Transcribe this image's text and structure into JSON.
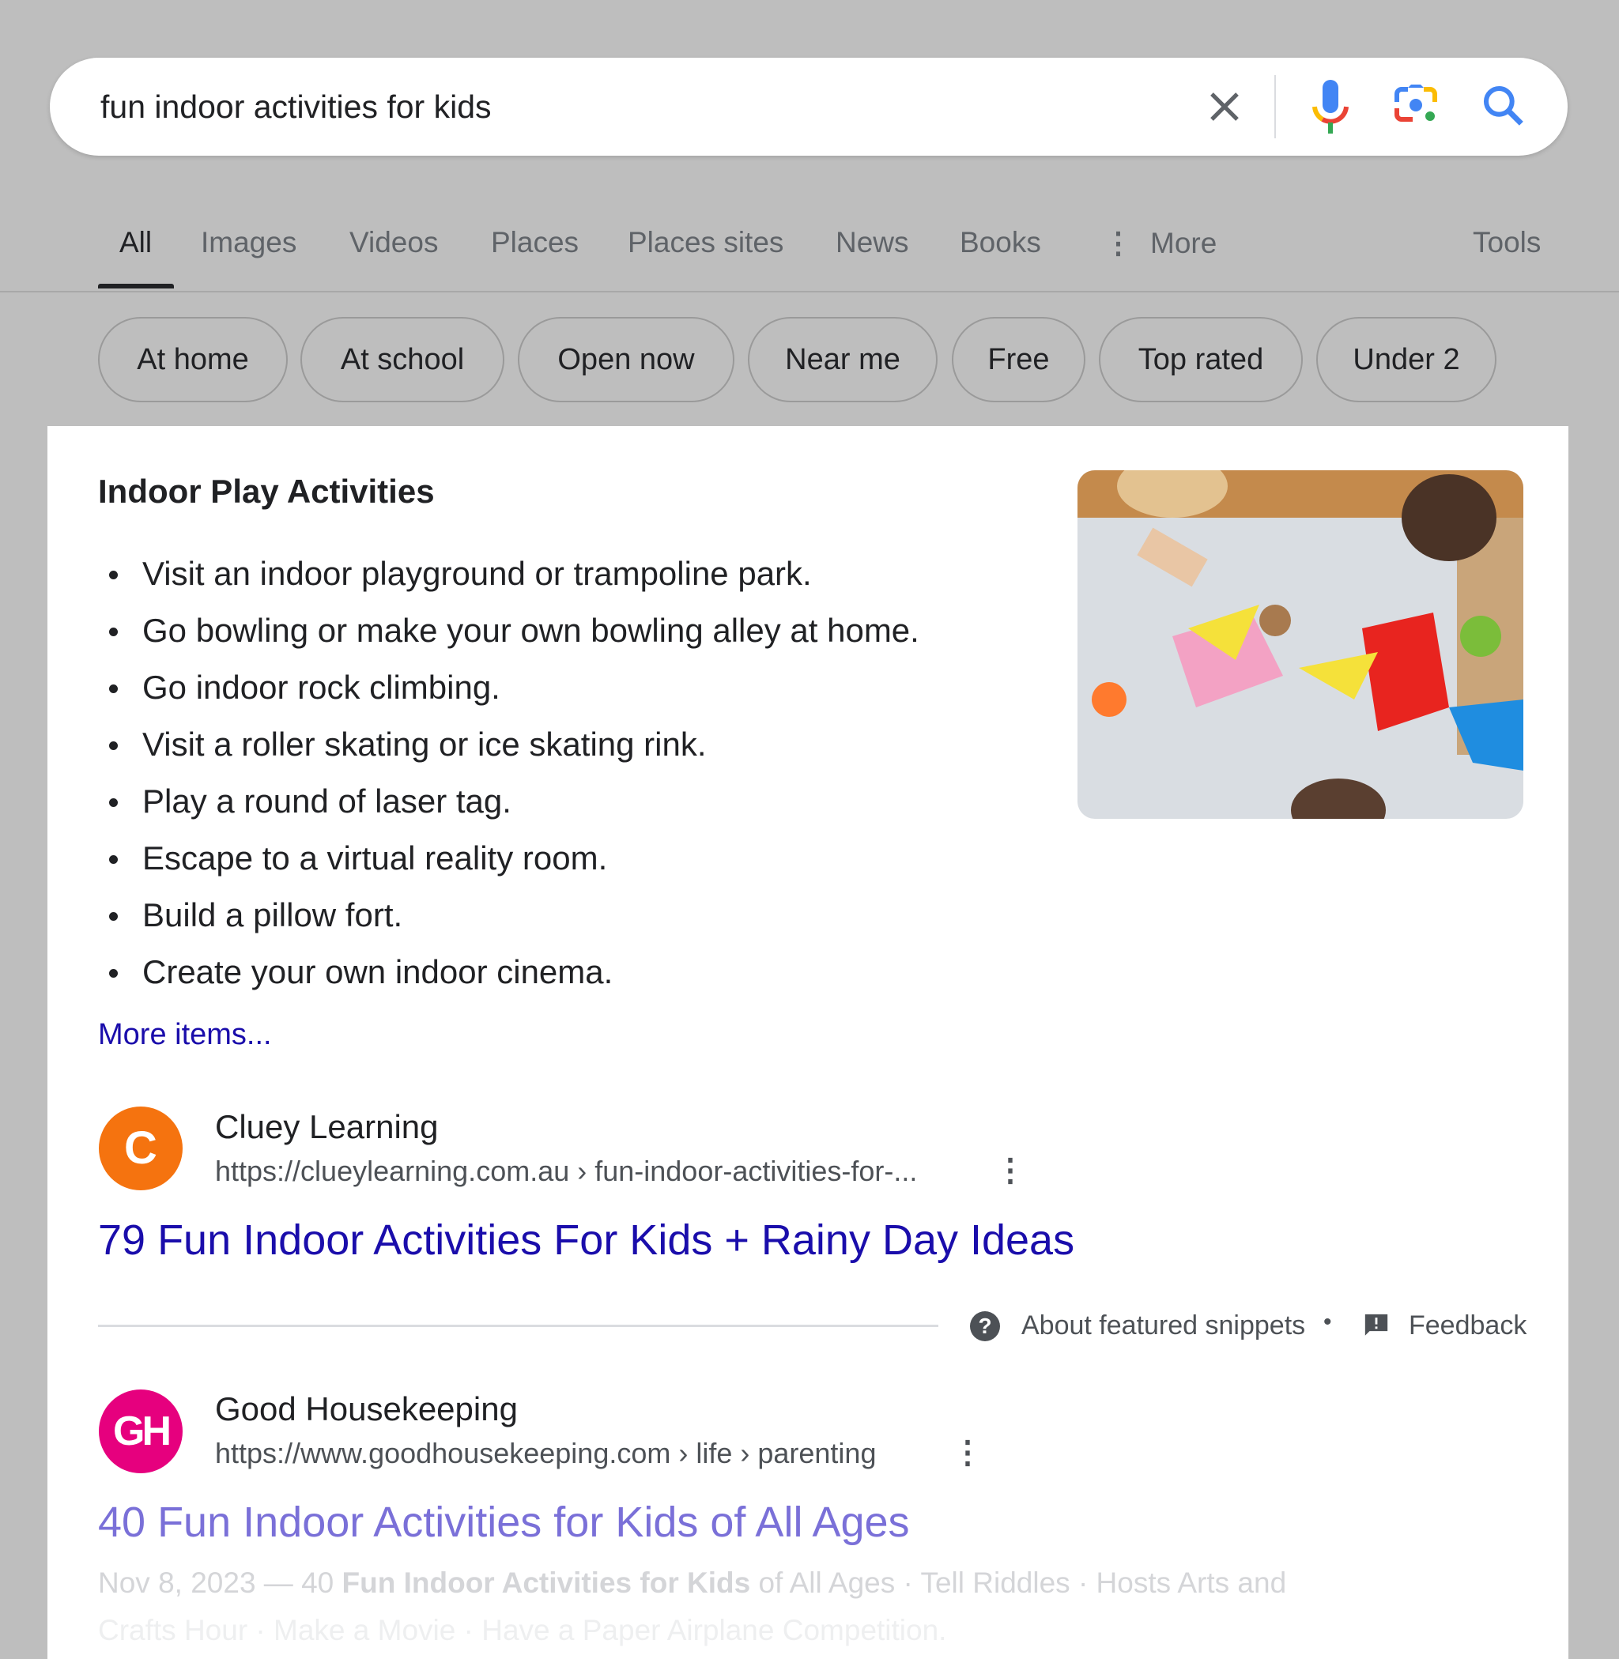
{
  "search": {
    "query": "fun indoor activities for kids",
    "icons": [
      "close-icon",
      "mic-icon",
      "lens-icon",
      "search-icon"
    ]
  },
  "tabs": [
    {
      "label": "All",
      "active": true
    },
    {
      "label": "Images"
    },
    {
      "label": "Videos"
    },
    {
      "label": "Places"
    },
    {
      "label": "Places sites"
    },
    {
      "label": "News"
    },
    {
      "label": "Books"
    },
    {
      "label": "More"
    }
  ],
  "tools_label": "Tools",
  "chips": [
    "At home",
    "At school",
    "Open now",
    "Near me",
    "Free",
    "Top rated",
    "Under 2"
  ],
  "snippet": {
    "title": "Indoor Play Activities",
    "items": [
      "Visit an indoor playground or trampoline park.",
      "Go bowling or make your own bowling alley at home.",
      "Go indoor rock climbing.",
      "Visit a roller skating or ice skating rink.",
      "Play a round of laser tag.",
      "Escape to a virtual reality room.",
      "Build a pillow fort.",
      "Create your own indoor cinema."
    ],
    "more_label": "More items...",
    "source": {
      "favicon_letter": "C",
      "name": "Cluey Learning",
      "url": "https://clueylearning.com.au › fun-indoor-activities-for-...",
      "title": "79 Fun Indoor Activities For Kids + Rainy Day Ideas"
    },
    "about_label": "About featured snippets",
    "separator": "•",
    "feedback_label": "Feedback"
  },
  "results": [
    {
      "favicon_letter": "GH",
      "name": "Good Housekeeping",
      "url": "https://www.goodhousekeeping.com › life › parenting",
      "title": "40 Fun Indoor Activities for Kids of All Ages",
      "date": "Nov 8, 2023 — 40 ",
      "bold": "Fun Indoor Activities for Kids",
      "rest": " of All Ages · Tell Riddles · Hosts Arts and",
      "line2": "Crafts Hour · Make a Movie · Have a Paper Airplane Competition."
    }
  ],
  "colors": {
    "link": "#1a0dab",
    "visited": "#681da8",
    "cluey": "#f5730f",
    "gh": "#e6007e"
  }
}
